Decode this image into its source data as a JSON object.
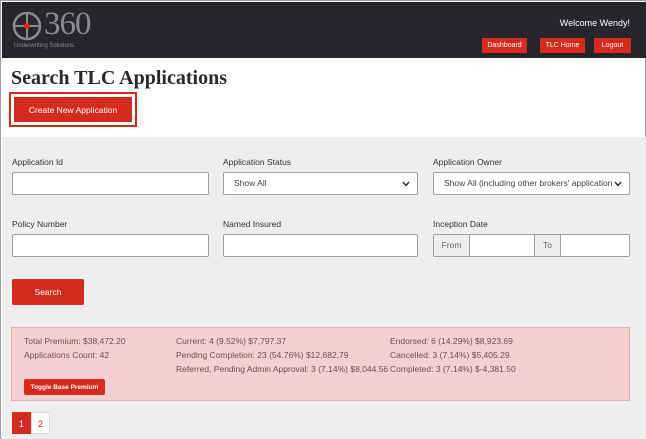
{
  "header": {
    "logo_text": "360",
    "logo_subtitle": "Underwriting Solutions",
    "welcome": "Welcome Wendy!",
    "nav": {
      "dashboard": "Dashboard",
      "tlc_home": "TLC Home",
      "logout": "Logout"
    }
  },
  "page": {
    "title": "Search TLC Applications",
    "create_button": "Create New Application"
  },
  "filters": {
    "application_id": {
      "label": "Application Id",
      "value": ""
    },
    "application_status": {
      "label": "Application Status",
      "selected": "Show All"
    },
    "application_owner": {
      "label": "Application Owner",
      "selected": "Show All (including other brokers' application"
    },
    "policy_number": {
      "label": "Policy Number",
      "value": ""
    },
    "named_insured": {
      "label": "Named Insured",
      "value": ""
    },
    "inception_date": {
      "label": "Inception Date",
      "from_label": "From",
      "to_label": "To"
    },
    "search_button": "Search"
  },
  "stats": {
    "total_premium": "Total Premium: $38,472.20",
    "applications_count": "Applications Count: 42",
    "current": "Current: 4 (9.52%) $7,797.37",
    "pending_completion": "Pending Completion: 23 (54.76%) $12,682.79",
    "referred": "Referred, Pending Admin Approval: 3 (7.14%) $8,044.56",
    "endorsed": "Endorsed: 6 (14.29%) $8,923.69",
    "cancelled": "Cancelled: 3 (7.14%) $5,405.29",
    "completed": "Completed: 3 (7.14%) $-4,381.50",
    "toggle_button": "Toggle Base Premium"
  },
  "pagination": {
    "pages": [
      "1",
      "2"
    ],
    "current": "1"
  },
  "colors": {
    "brand_red": "#d52b1e",
    "header_bg": "#26262c",
    "panel_bg": "#eeeeee",
    "stats_bg": "#f5d0d0"
  }
}
